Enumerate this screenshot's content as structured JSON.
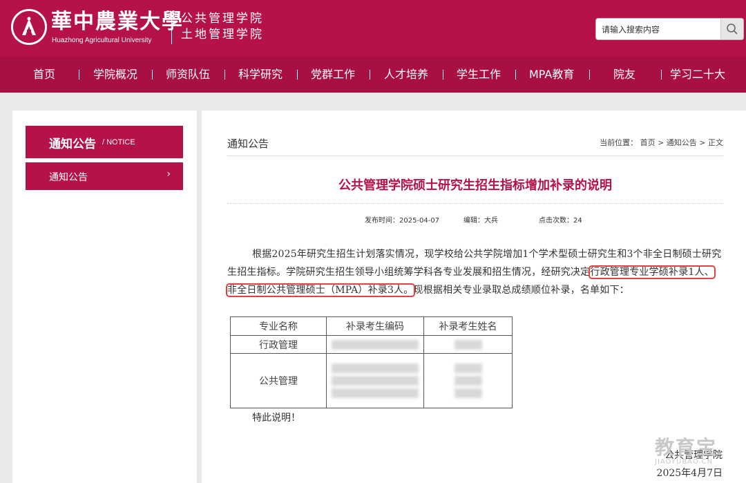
{
  "header": {
    "university_cn": "華中農業大學",
    "university_en": "Huazhong Agricultural University",
    "college_line1": "公共管理学院",
    "college_line2": "土地管理学院",
    "search_placeholder": "请输入搜索内容"
  },
  "nav": [
    "首页",
    "学院概况",
    "师资队伍",
    "科学研究",
    "党群工作",
    "人才培养",
    "学生工作",
    "MPA教育",
    "院友",
    "学习二十大"
  ],
  "sidebar": {
    "title_cn": "通知公告",
    "title_en": "/ NOTICE",
    "item": "通知公告",
    "chevron": "›"
  },
  "content": {
    "section_title": "通知公告",
    "breadcrumb": "当前位置： 首页 > 通知公告 > 正文",
    "title": "公共管理学院硕士研究生招生指标增加补录的说明",
    "publish_time": "发布时间：2025-04-07",
    "editor": "编辑：大兵",
    "clicks": "点击次数：24",
    "para_part1": "根据2025年研究生招生计划落实情况，现学校给公共学院增加1个学术型硕士研究生和3个非全日制硕士研究生招生指标。学院研究生招生领导小组统筹学科各专业发展和招生情况，经研究决定",
    "para_highlight": "行政管理专业学硕补录1人、非全日制公共管理硕士（MPA）补录3人。",
    "para_part2": "现根据相关专业录取总成绩顺位补录，名单如下：",
    "table": {
      "headers": [
        "专业名称",
        "补录考生编码",
        "补录考生姓名"
      ],
      "rows": [
        "行政管理",
        "公共管理"
      ]
    },
    "closing": "特此说明！",
    "sign_org": "公共管理学院",
    "sign_date": "2025年4月7日"
  },
  "watermark": {
    "cn": "教育宝",
    "en": "JIAOYUBAO.CN"
  }
}
